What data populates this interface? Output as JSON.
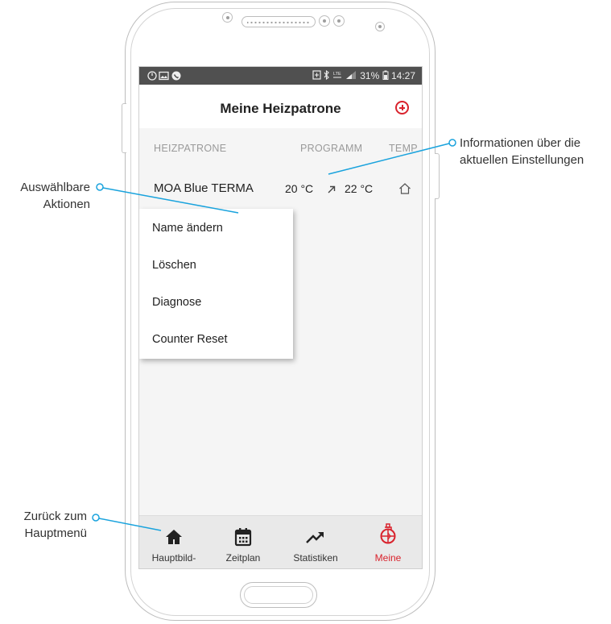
{
  "statusbar": {
    "right_text": "31%",
    "time": "14:27",
    "network": "LTE"
  },
  "header": {
    "title": "Meine Heizpatrone"
  },
  "table": {
    "columns": [
      "HEIZPATRONE",
      "PROGRAMM",
      "TEMP"
    ],
    "row": {
      "name": "MOA Blue TERMA",
      "temp_from": "20 °C",
      "temp_to": "22 °C"
    }
  },
  "context_menu": {
    "items": [
      "Name ändern",
      "Löschen",
      "Diagnose",
      "Counter Reset"
    ]
  },
  "bottom_nav": {
    "items": [
      {
        "label": "Hauptbild-",
        "icon": "home-icon"
      },
      {
        "label": "Zeitplan",
        "icon": "calendar-icon"
      },
      {
        "label": "Statistiken",
        "icon": "trending-up-icon"
      },
      {
        "label": "Meine",
        "icon": "heater-cartridge-icon",
        "active": true
      }
    ]
  },
  "annotations": {
    "actions": [
      "Auswählbare",
      "Aktionen"
    ],
    "settings": [
      "Informationen über die",
      "aktuellen Einstellungen"
    ],
    "back": [
      "Zurück zum",
      "Hauptmenü"
    ]
  },
  "colors": {
    "accent": "#d9232d",
    "leader_line": "#1aa3dd",
    "statusbar": "#505050",
    "navbar": "#e9e9e9"
  }
}
